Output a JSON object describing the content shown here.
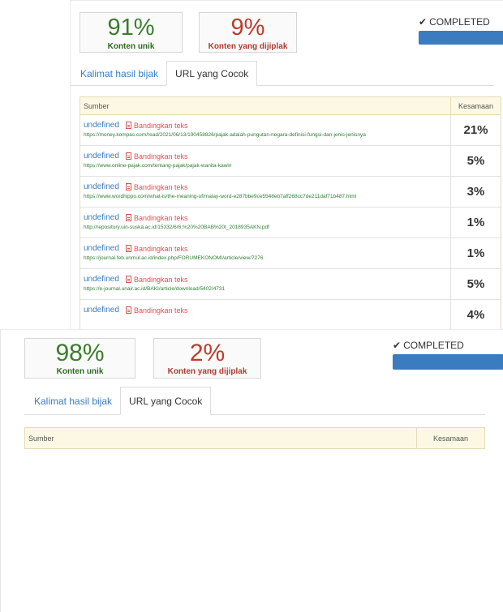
{
  "panel1": {
    "unique_pct": "91%",
    "unique_label": "Konten unik",
    "plag_pct": "9%",
    "plag_label": "Konten yang dijiplak",
    "status": "COMPLETED",
    "tabs": [
      "Kalimat hasil bijak",
      "URL yang Cocok"
    ],
    "table": {
      "headers": [
        "Sumber",
        "Kesamaan"
      ],
      "rows": [
        {
          "name": "undefined",
          "compare": "Bandingkan teks",
          "url": "https://money.kompas.com/read/2021/06/13/190458826/pajak-adalah-pungutan-negara-definisi-fungsi-dan-jenis-jenisnya",
          "similarity": "21%"
        },
        {
          "name": "undefined",
          "compare": "Bandingkan teks",
          "url": "https://www.online-pajak.com/tentang-pajak/pajak-wanita-kawin",
          "similarity": "5%"
        },
        {
          "name": "undefined",
          "compare": "Bandingkan teks",
          "url": "https://www.wordhippo.com/what-is/the-meaning-of/malay-word-e287bbe9ce5548eb7aff268cc7de211daf71b487.html",
          "similarity": "3%"
        },
        {
          "name": "undefined",
          "compare": "Bandingkan teks",
          "url": "http://repository.uin-suska.ac.id/15332/6/6.%20%20BAB%20I_2018935AKN.pdf",
          "similarity": "1%"
        },
        {
          "name": "undefined",
          "compare": "Bandingkan teks",
          "url": "https://journal.feb.unmul.ac.id/index.php/FORUMEKONOMI/article/view/7276",
          "similarity": "1%"
        },
        {
          "name": "undefined",
          "compare": "Bandingkan teks",
          "url": "https://e-journal.unair.ac.id/BAKI/article/download/5402/4731",
          "similarity": "5%"
        },
        {
          "name": "undefined",
          "compare": "Bandingkan teks",
          "url": "",
          "similarity": "4%"
        }
      ]
    }
  },
  "panel2": {
    "unique_pct": "98%",
    "unique_label": "Konten unik",
    "plag_pct": "2%",
    "plag_label": "Konten yang dijiplak",
    "status": "COMPLETED",
    "tabs": [
      "Kalimat hasil bijak",
      "URL yang Cocok"
    ],
    "table": {
      "headers": [
        "Sumber",
        "Kesamaan"
      ]
    }
  },
  "icons": {
    "check": "check-icon",
    "compare": "document-icon"
  },
  "colors": {
    "unique": "#3a7d2c",
    "plagiarized": "#c0392b",
    "link": "#3a7cbf",
    "compare_link": "#d9534f",
    "url": "#2e7d32",
    "table_header_bg": "#fcf8e3",
    "progress_bar": "#3a7cbf"
  }
}
